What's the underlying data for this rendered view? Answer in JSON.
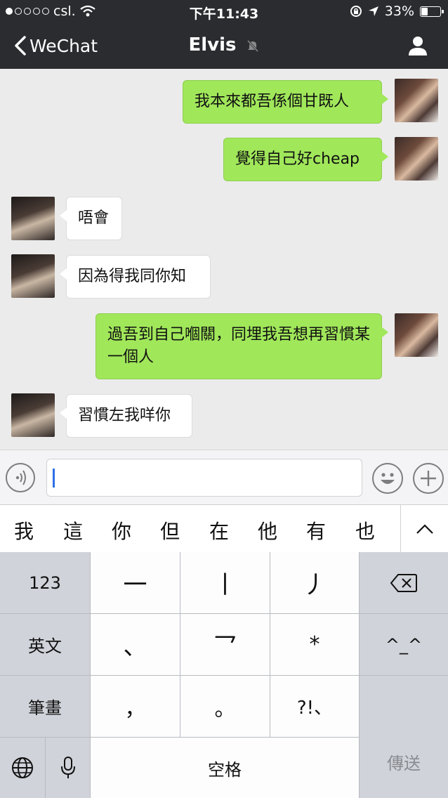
{
  "status_bar": {
    "carrier": "csl.",
    "time": "下午11:43",
    "battery": "33%",
    "battery_level": 0.33
  },
  "nav": {
    "back_label": "WeChat",
    "title": "Elvis"
  },
  "messages": [
    {
      "sender": "me",
      "text": "我本來都吾係個甘既人"
    },
    {
      "sender": "me",
      "text": "覺得自己好cheap"
    },
    {
      "sender": "them",
      "text": "唔會"
    },
    {
      "sender": "them",
      "text": "因為得我同你知"
    },
    {
      "sender": "me",
      "text": "過吾到自己嗰關，同埋我吾想再習慣某一個人"
    },
    {
      "sender": "them",
      "text": "習慣左我咩你"
    }
  ],
  "input": {
    "value": "",
    "placeholder": ""
  },
  "candidates": [
    "我",
    "這",
    "你",
    "但",
    "在",
    "他",
    "有",
    "也"
  ],
  "keyboard": {
    "numbers_key": "123",
    "english_key": "英文",
    "stroke_key": "筆畫",
    "stroke_horizontal": "一",
    "stroke_vertical": "丨",
    "stroke_left": "丿",
    "stroke_dot": "、",
    "stroke_turn": "乛",
    "wildcard": "*",
    "emoticon_key": "^_^",
    "comma_key": "，",
    "period_key": "。",
    "punct_key": "?!、",
    "space_key": "空格",
    "send_key": "傳送"
  }
}
